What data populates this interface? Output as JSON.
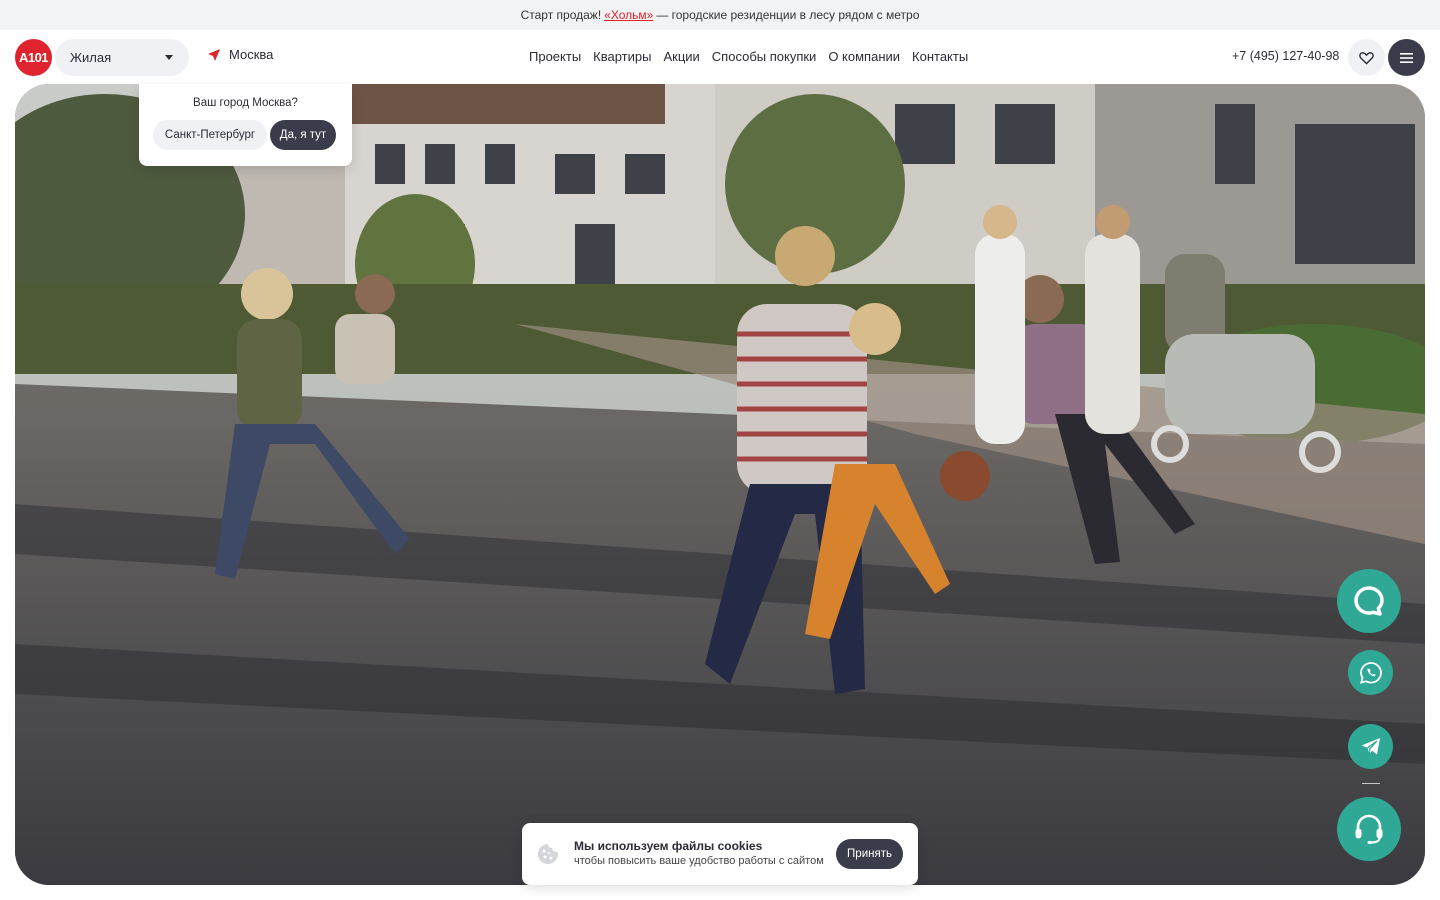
{
  "promo": {
    "prefix": "Старт продаж!",
    "link": "«Хольм»",
    "suffix": "— городские резиденции в лесу рядом с метро"
  },
  "header": {
    "logo": "A101",
    "type_select": "Жилая",
    "city": "Москва",
    "nav": [
      "Проекты",
      "Квартиры",
      "Акции",
      "Способы покупки",
      "О компании",
      "Контакты"
    ],
    "phone": "+7 (495) 127-40-98"
  },
  "city_popup": {
    "question": "Ваш город Москва?",
    "alt_city": "Санкт-Петербург",
    "confirm": "Да, я тут"
  },
  "cookie": {
    "title": "Мы используем файлы cookies",
    "subtitle": "чтобы повысить ваше удобство работы с сайтом",
    "accept": "Принять"
  },
  "colors": {
    "brand_red": "#e0242f",
    "dark": "#3b3c4b",
    "teal": "#2fa895"
  }
}
